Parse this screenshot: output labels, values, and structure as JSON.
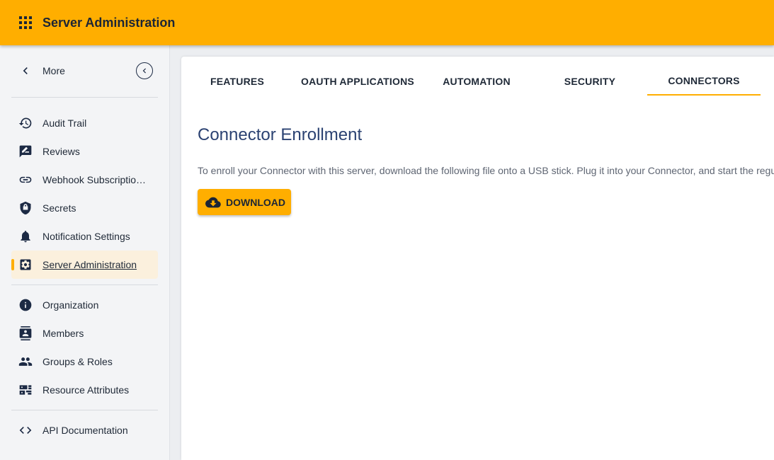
{
  "header": {
    "title": "Server Administration",
    "brand_color": "#ffae00"
  },
  "sidebar": {
    "more_label": "More",
    "groups": [
      [
        {
          "label": "Audit Trail",
          "icon": "history-icon"
        },
        {
          "label": "Reviews",
          "icon": "rate-review-icon"
        },
        {
          "label": "Webhook Subscriptio…",
          "icon": "link-icon"
        },
        {
          "label": "Secrets",
          "icon": "shield-lock-icon"
        },
        {
          "label": "Notification Settings",
          "icon": "bell-icon"
        },
        {
          "label": "Server Administration",
          "icon": "settings-box-icon",
          "active": true
        }
      ],
      [
        {
          "label": "Organization",
          "icon": "info-icon"
        },
        {
          "label": "Members",
          "icon": "contact-icon"
        },
        {
          "label": "Groups & Roles",
          "icon": "people-icon"
        },
        {
          "label": "Resource Attributes",
          "icon": "dns-attribute-icon"
        }
      ],
      [
        {
          "label": "API Documentation",
          "icon": "code-icon"
        }
      ]
    ]
  },
  "tabs": [
    {
      "label": "FEATURES"
    },
    {
      "label": "OAUTH APPLICATIONS"
    },
    {
      "label": "AUTOMATION"
    },
    {
      "label": "SECURITY"
    },
    {
      "label": "CONNECTORS",
      "active": true
    }
  ],
  "content": {
    "heading": "Connector Enrollment",
    "description": "To enroll your Connector with this server, download the following file onto a USB stick. Plug it into your Connector, and start the regu",
    "download_label": "DOWNLOAD"
  }
}
